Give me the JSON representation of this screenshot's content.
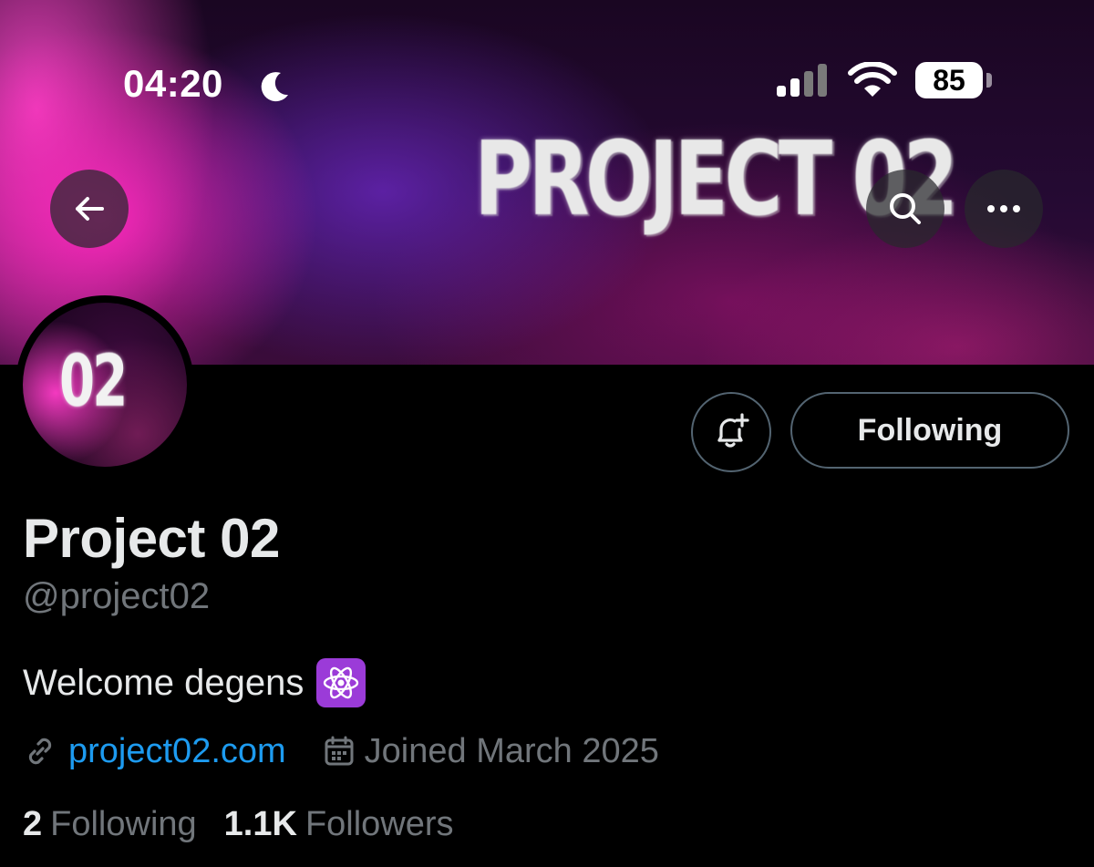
{
  "status_bar": {
    "time": "04:20",
    "battery": "85"
  },
  "banner": {
    "title": "PROJECT 02"
  },
  "avatar": {
    "text": "02"
  },
  "actions": {
    "following_label": "Following"
  },
  "profile": {
    "display_name": "Project 02",
    "handle": "@project02",
    "bio": "Welcome degens",
    "website": "project02.com",
    "joined": "Joined March 2025",
    "following_count": "2",
    "following_label": "Following",
    "followers_count": "1.1K",
    "followers_label": "Followers"
  },
  "icons": {
    "back": "arrow-left-icon",
    "search": "search-icon",
    "more": "more-horizontal-icon",
    "notify": "bell-plus-icon",
    "link": "link-icon",
    "calendar": "calendar-icon",
    "bio_emoji": "atom-icon"
  },
  "colors": {
    "background": "#000000",
    "primary_text": "#e7e9ea",
    "secondary_text": "#71767b",
    "link": "#1d9bf0",
    "border": "#536471"
  }
}
